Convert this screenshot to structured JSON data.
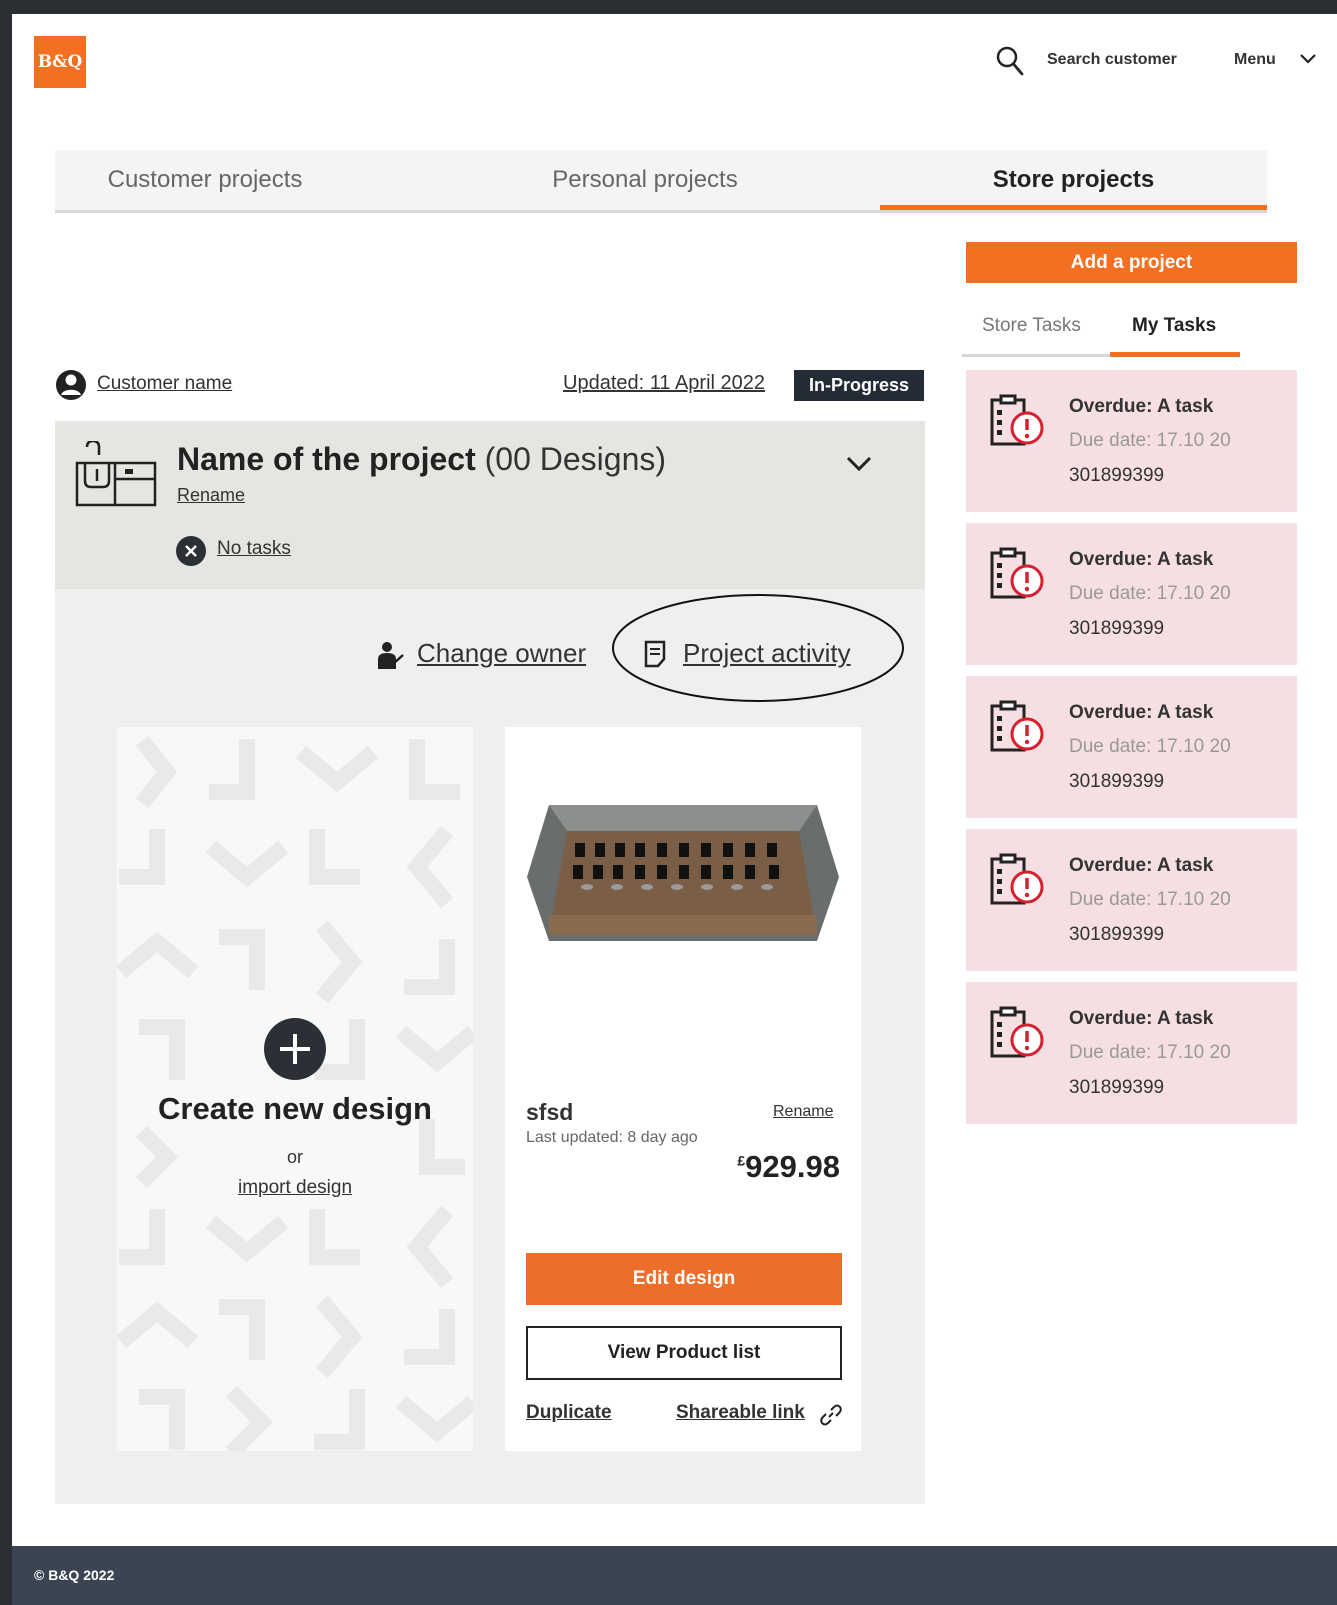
{
  "header": {
    "logo_text": "B&Q",
    "search_label": "Search customer",
    "menu_label": "Menu"
  },
  "tabs": [
    {
      "label": "Customer projects"
    },
    {
      "label": "Personal projects"
    },
    {
      "label": "Store projects"
    }
  ],
  "sidebar": {
    "add_project_label": "Add a project",
    "subtabs": [
      {
        "label": "Store Tasks"
      },
      {
        "label": "My Tasks"
      }
    ],
    "tasks": [
      {
        "title": "Overdue: A task",
        "due": "Due date: 17.10 20",
        "number": "301899399"
      },
      {
        "title": "Overdue: A task",
        "due": "Due date: 17.10 20",
        "number": "301899399"
      },
      {
        "title": "Overdue: A task",
        "due": "Due date: 17.10 20",
        "number": "301899399"
      },
      {
        "title": "Overdue: A task",
        "due": "Due date: 17.10 20",
        "number": "301899399"
      },
      {
        "title": "Overdue: A task",
        "due": "Due date: 17.10 20",
        "number": "301899399"
      }
    ]
  },
  "project": {
    "customer_name": "Customer name",
    "updated": "Updated: 11 April 2022",
    "status": "In-Progress",
    "name": "Name of the project",
    "designs_count": "(00 Designs)",
    "rename_label": "Rename",
    "no_tasks_label": "No tasks",
    "change_owner_label": "Change owner",
    "project_activity_label": "Project activity"
  },
  "create_card": {
    "title": "Create new design",
    "or": "or",
    "import_label": "import design"
  },
  "design_card": {
    "name": "sfsd",
    "rename_label": "Rename",
    "last_updated": "Last updated: 8 day ago",
    "currency": "£",
    "price": "929.98",
    "edit_label": "Edit design",
    "view_list_label": "View Product list",
    "duplicate_label": "Duplicate",
    "share_label": "Shareable link"
  },
  "footer": {
    "copyright": "© B&Q 2022"
  },
  "colors": {
    "brand": "#f36f21",
    "task_bg": "#f6dfe2",
    "badge_bg": "#222b36",
    "footer_bg": "#3a4453",
    "alert_red": "#d6202f"
  }
}
